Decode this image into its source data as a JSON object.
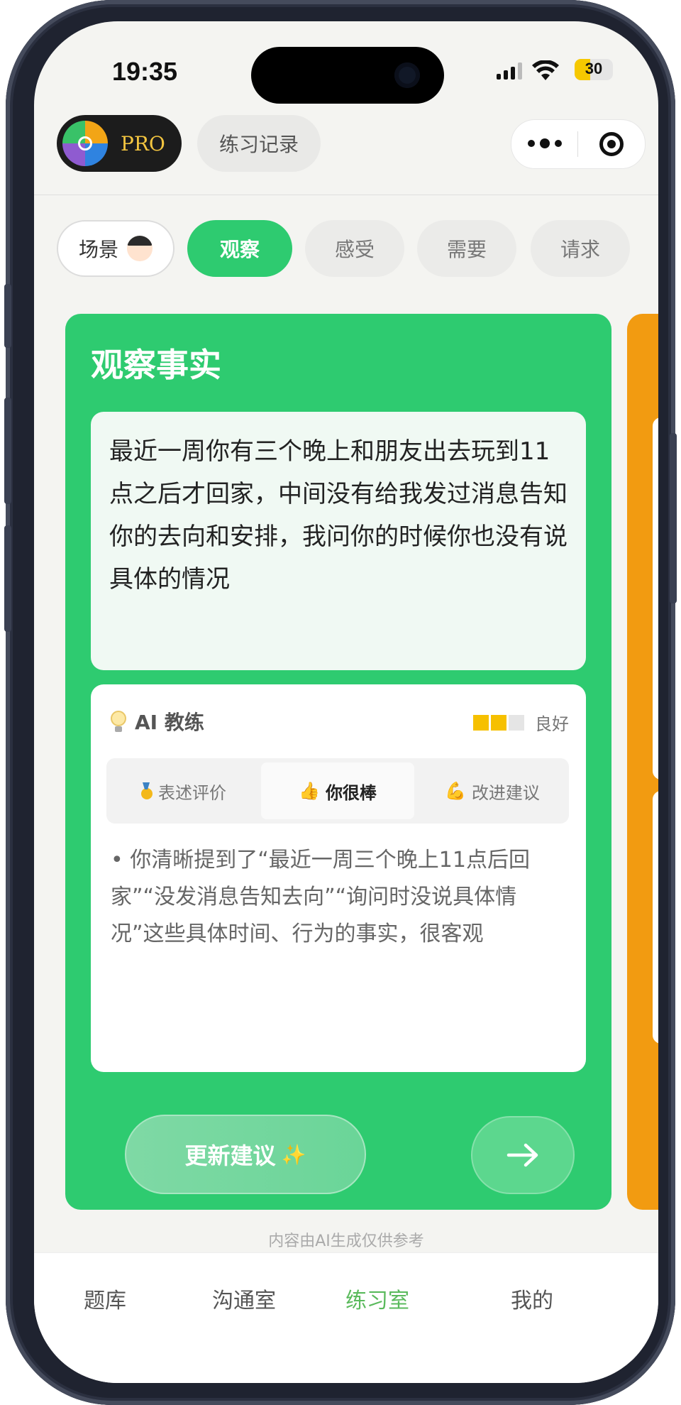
{
  "status_bar": {
    "time": "19:35",
    "battery": "30"
  },
  "header": {
    "pro_label": "PRO",
    "record_label": "练习记录"
  },
  "tabs": [
    {
      "label": "场景",
      "state": "default"
    },
    {
      "label": "观察",
      "state": "active"
    },
    {
      "label": "感受",
      "state": "inactive"
    },
    {
      "label": "需要",
      "state": "inactive"
    },
    {
      "label": "请求",
      "state": "inactive"
    }
  ],
  "card": {
    "title": "观察事实",
    "observation_text": "最近一周你有三个晚上和朋友出去玩到11点之后才回家，中间没有给我发过消息告知你的去向和安排，我问你的时候你也没有说具体的情况",
    "coach": {
      "title": "AI 教练",
      "rating_label": "良好",
      "rating_level": "2/3",
      "segments": [
        "表述评价",
        "你很棒",
        "改进建议"
      ],
      "active_segment": "你很棒",
      "feedback": "• 你清晰提到了“最近一周三个晚上11点后回家”“没发消息告知去向”“询问时没说具体情况”这些具体时间、行为的事实，很客观"
    },
    "update_button": "更新建议",
    "sparkle_icon": "✨"
  },
  "disclaimer": "内容由AI生成仅供参考",
  "bottom_nav": [
    {
      "label": "题库",
      "active": false
    },
    {
      "label": "沟通室",
      "active": false
    },
    {
      "label": "练习室",
      "active": true
    },
    {
      "label": "我的",
      "active": false
    }
  ],
  "colors": {
    "accent": "#2ecb70",
    "next_card": "#f29b11",
    "nav_active": "#5aba5c",
    "pro_text": "#f3c540"
  }
}
